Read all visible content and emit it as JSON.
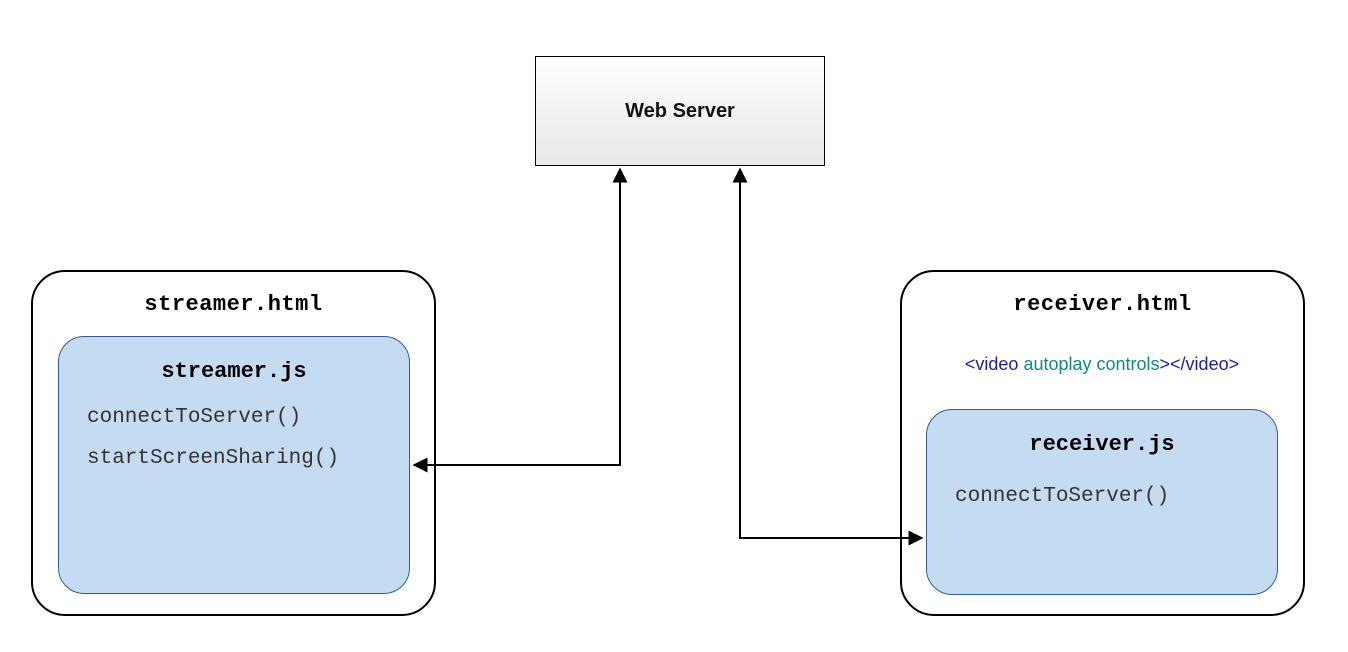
{
  "server": {
    "label": "Web Server"
  },
  "streamer": {
    "outer_title": "streamer.html",
    "inner_title": "streamer.js",
    "fn1": "connectToServer()",
    "fn2": "startScreenSharing()"
  },
  "receiver": {
    "outer_title": "receiver.html",
    "inner_title": "receiver.js",
    "fn1": "connectToServer()",
    "video_tag_open": "<video",
    "video_attr1": " autoplay",
    "video_attr2": " controls",
    "video_tag_mid": ">",
    "video_tag_close": "</video>"
  }
}
